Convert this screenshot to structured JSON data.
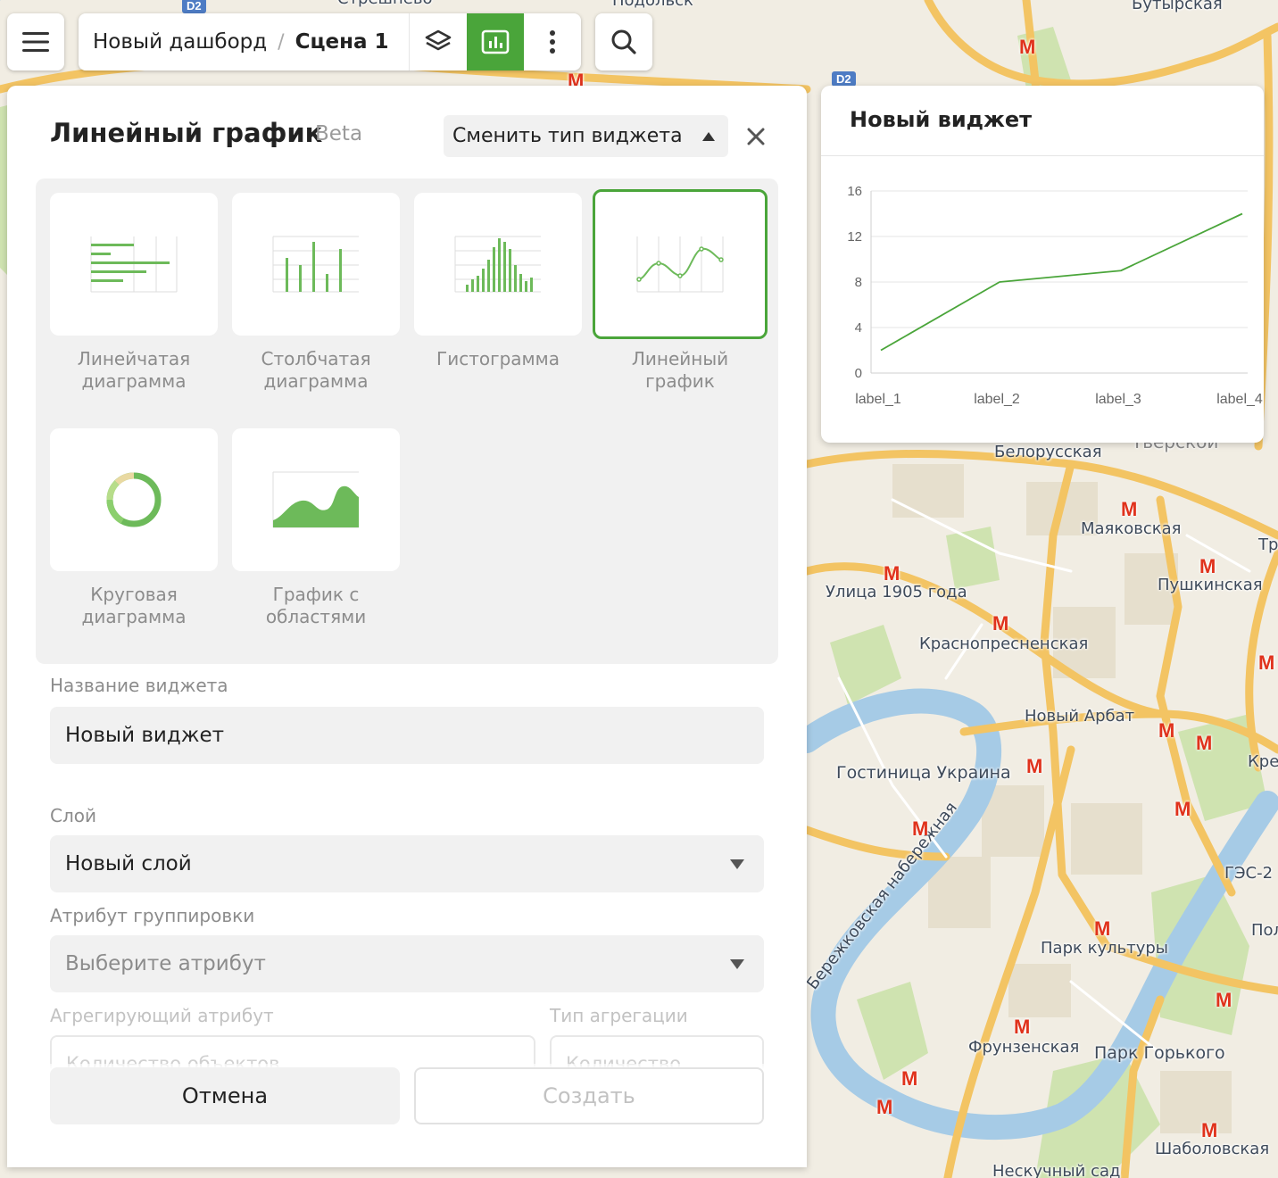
{
  "map": {
    "labels": [
      "Бутырская",
      "Белорусская",
      "Тверской",
      "Маяковская",
      "Пушкинская",
      "Улица 1905 года",
      "Краснопресненская",
      "Новый Арбат",
      "Гостиница Украина",
      "Бережковская набережная",
      "ГЭС-2",
      "Парк культуры",
      "Фрунзенская",
      "Парк Горького",
      "Нескучный сад",
      "Шаболовская",
      "Подольск",
      "Стрешнево",
      "Тр",
      "Кре",
      "Пол"
    ],
    "shields": [
      "D2",
      "D2"
    ]
  },
  "topbar": {
    "dashboard_name": "Новый дашборд",
    "separator": "/",
    "scene_name": "Сцена 1",
    "icons": [
      "menu-icon",
      "layers-icon",
      "chart-icon",
      "more-icon",
      "search-icon"
    ],
    "accent": "#4aa53a"
  },
  "panel": {
    "title": "Линейный график",
    "badge": "Beta",
    "change_type_label": "Сменить тип виджета",
    "types": [
      {
        "label": "Линейчатая диаграмма",
        "icon": "horizontal-bar-chart-icon",
        "selected": false
      },
      {
        "label": "Столбчатая диаграмма",
        "icon": "vertical-bar-chart-icon",
        "selected": false
      },
      {
        "label": "Гистограмма",
        "icon": "histogram-icon",
        "selected": false
      },
      {
        "label": "Линейный график",
        "icon": "line-chart-icon",
        "selected": true
      },
      {
        "label": "Круговая диаграмма",
        "icon": "pie-chart-icon",
        "selected": false
      },
      {
        "label": "График с областями",
        "icon": "area-chart-icon",
        "selected": false
      }
    ],
    "widget_name_label": "Название виджета",
    "widget_name_value": "Новый виджет",
    "layer_label": "Слой",
    "layer_value": "Новый слой",
    "group_attr_label": "Атрибут группировки",
    "group_attr_placeholder": "Выберите атрибут",
    "agg_attr_label": "Агрегирующий атрибут",
    "agg_attr_value": "Количество объектов",
    "agg_type_label": "Тип агрегации",
    "agg_type_value": "Количество",
    "cancel_label": "Отмена",
    "create_label": "Создать"
  },
  "widget": {
    "title": "Новый виджет"
  },
  "chart_data": {
    "type": "line",
    "categories": [
      "label_1",
      "label_2",
      "label_3",
      "label_4"
    ],
    "series": [
      {
        "values": [
          2,
          8,
          9,
          14
        ]
      }
    ],
    "ylim": [
      0,
      16
    ],
    "yticks": [
      0,
      4,
      8,
      12,
      16
    ],
    "grid": true,
    "color": "#4aa53a"
  }
}
